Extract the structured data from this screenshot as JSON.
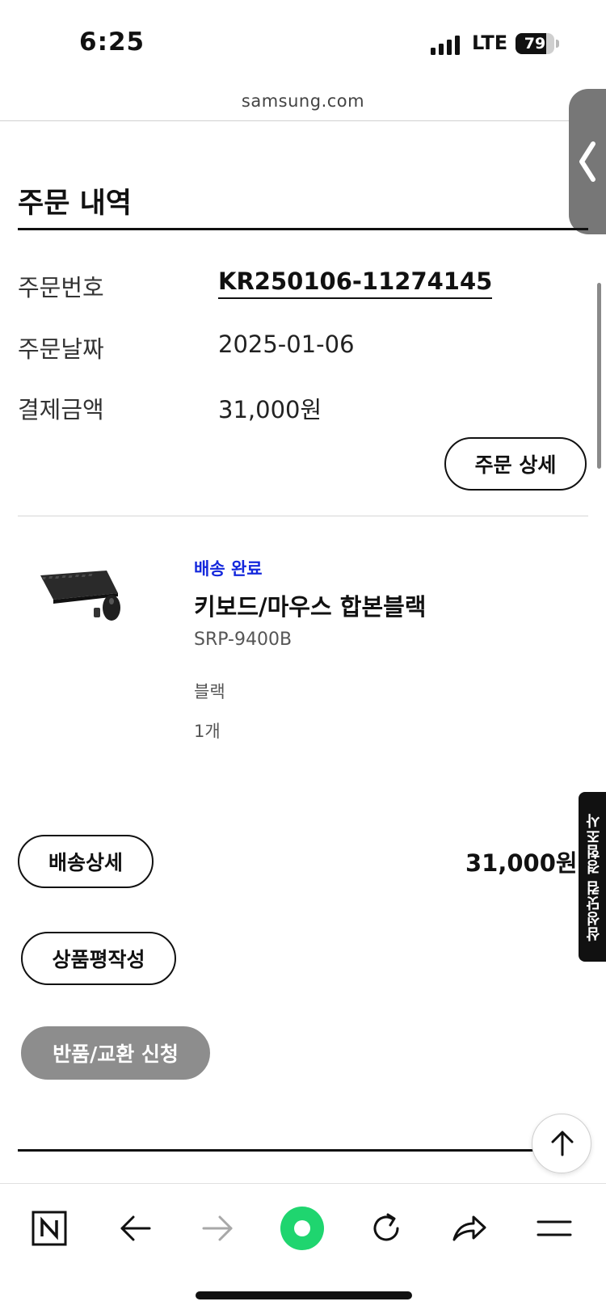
{
  "status_bar": {
    "time": "6:25",
    "network": "LTE",
    "battery": "79",
    "battery_level": 0.79
  },
  "browser": {
    "url": "samsung.com"
  },
  "section": {
    "title": "주문 내역"
  },
  "order": {
    "number_label": "주문번호",
    "number_value": "KR250106-11274145",
    "date_label": "주문날짜",
    "date_value": "2025-01-06",
    "amount_label": "결제금액",
    "amount_value": "31,000원",
    "detail_button": "주문 상세"
  },
  "product": {
    "status": "배송 완료",
    "name": "키보드/마우스 합본블랙",
    "model": "SRP-9400B",
    "color": "블랙",
    "quantity": "1개",
    "price": "31,000원"
  },
  "actions": {
    "delivery_detail": "배송상세",
    "write_review": "상품평작성",
    "return_exchange": "반품/교환 신청"
  },
  "survey_tab": "삼성닷컴 경험조사",
  "toolbar_icons": [
    "naver-icon",
    "back-arrow-icon",
    "forward-arrow-icon",
    "green-dot-icon",
    "refresh-icon",
    "share-icon",
    "menu-icon"
  ]
}
